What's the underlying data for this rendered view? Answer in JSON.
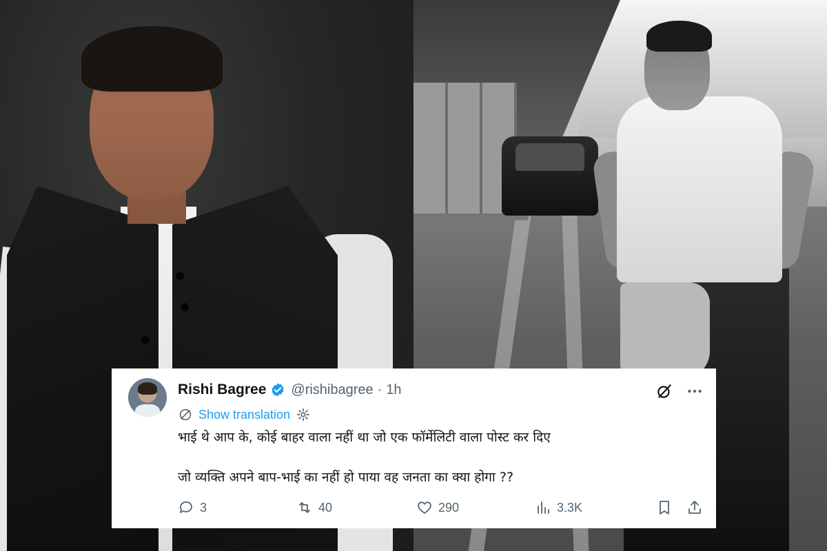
{
  "tweet": {
    "author_name": "Rishi Bagree",
    "author_handle": "@rishibagree",
    "separator": "·",
    "time": "1h",
    "show_translation": "Show translation",
    "text_line_1": "भाई थे आप के, कोई बाहर वाला नहीं था जो एक फॉर्मेलिटी वाला पोस्ट कर दिए",
    "text_line_2": "जो व्यक्ति अपने बाप-भाई का नहीं हो पाया वह जनता का क्या होगा ??",
    "replies": "3",
    "reposts": "40",
    "likes": "290",
    "views": "3.3K"
  },
  "icons": {
    "verified": "verified-badge-icon",
    "grok": "grok-icon",
    "more": "more-options-icon",
    "translate": "translate-globe-icon",
    "settings": "settings-gear-icon",
    "reply": "reply-icon",
    "repost": "repost-icon",
    "like": "like-heart-icon",
    "views": "views-chart-icon",
    "bookmark": "bookmark-icon",
    "share": "share-icon"
  },
  "colors": {
    "verified_blue": "#1d9bf0",
    "link_blue": "#1d9bf0",
    "text_primary": "#0f1419",
    "text_secondary": "#536471"
  }
}
